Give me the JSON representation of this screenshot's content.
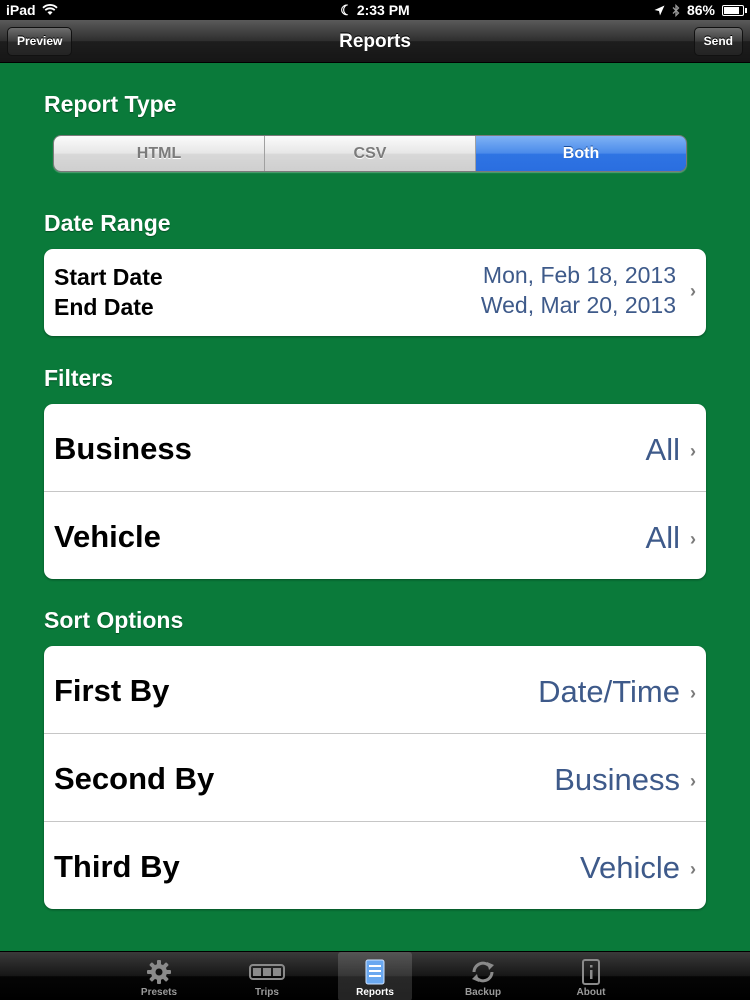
{
  "status_bar": {
    "device": "iPad",
    "time": "2:33 PM",
    "battery": "86%",
    "battery_level": 0.86
  },
  "nav": {
    "title": "Reports",
    "left_button": "Preview",
    "right_button": "Send"
  },
  "report_type": {
    "title": "Report Type",
    "options": [
      "HTML",
      "CSV",
      "Both"
    ],
    "selected": "Both"
  },
  "date_range": {
    "title": "Date Range",
    "start_label": "Start Date",
    "end_label": "End Date",
    "start_value": "Mon, Feb 18, 2013",
    "end_value": "Wed, Mar 20, 2013"
  },
  "filters": {
    "title": "Filters",
    "rows": [
      {
        "label": "Business",
        "value": "All"
      },
      {
        "label": "Vehicle",
        "value": "All"
      }
    ]
  },
  "sort_options": {
    "title": "Sort Options",
    "rows": [
      {
        "label": "First By",
        "value": "Date/Time"
      },
      {
        "label": "Second By",
        "value": "Business"
      },
      {
        "label": "Third By",
        "value": "Vehicle"
      }
    ]
  },
  "tabs": [
    {
      "label": "Presets",
      "icon": "gear-icon",
      "active": false
    },
    {
      "label": "Trips",
      "icon": "trips-icon",
      "active": false
    },
    {
      "label": "Reports",
      "icon": "reports-icon",
      "active": true
    },
    {
      "label": "Backup",
      "icon": "sync-icon",
      "active": false
    },
    {
      "label": "About",
      "icon": "info-icon",
      "active": false
    }
  ],
  "colors": {
    "background": "#0a7a3a",
    "selected_segment": "#2f74e3",
    "value_text": "#3e5a8a"
  }
}
